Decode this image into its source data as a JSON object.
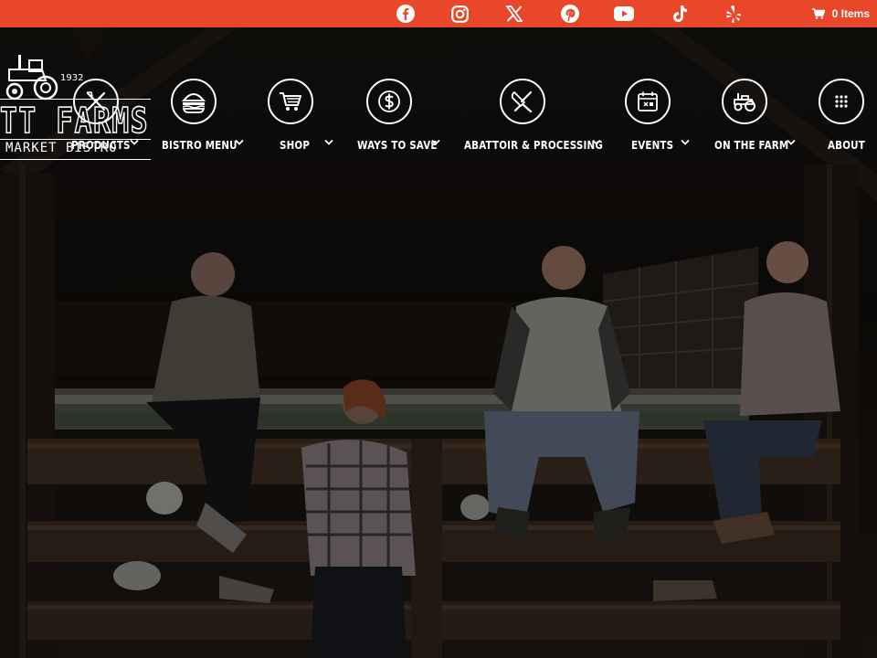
{
  "topbar": {
    "background": "#e8472a",
    "socials": [
      {
        "name": "facebook-icon"
      },
      {
        "name": "instagram-icon"
      },
      {
        "name": "x-twitter-icon"
      },
      {
        "name": "pinterest-icon"
      },
      {
        "name": "youtube-icon"
      },
      {
        "name": "tiktok-icon"
      },
      {
        "name": "yelp-icon"
      }
    ],
    "cart": {
      "icon": "cart-icon",
      "label": "0 Items"
    }
  },
  "logo": {
    "year": "1932",
    "name": "TT FARMS",
    "tagline": "MARKET  BISTRO"
  },
  "nav": {
    "items": [
      {
        "label": "PRODUCTS",
        "icon": "crossed-utensils-icon"
      },
      {
        "label": "BISTRO MENU",
        "icon": "burger-icon"
      },
      {
        "label": "SHOP",
        "icon": "shopping-cart-icon"
      },
      {
        "label": "WAYS TO SAVE",
        "icon": "dollar-icon"
      },
      {
        "label": "ABATTOIR & PROCESSING",
        "icon": "cleaver-icon"
      },
      {
        "label": "EVENTS",
        "icon": "calendar-icon"
      },
      {
        "label": "ON THE FARM",
        "icon": "tractor-icon"
      },
      {
        "label": "ABOUT",
        "icon": "grid-icon"
      }
    ]
  }
}
